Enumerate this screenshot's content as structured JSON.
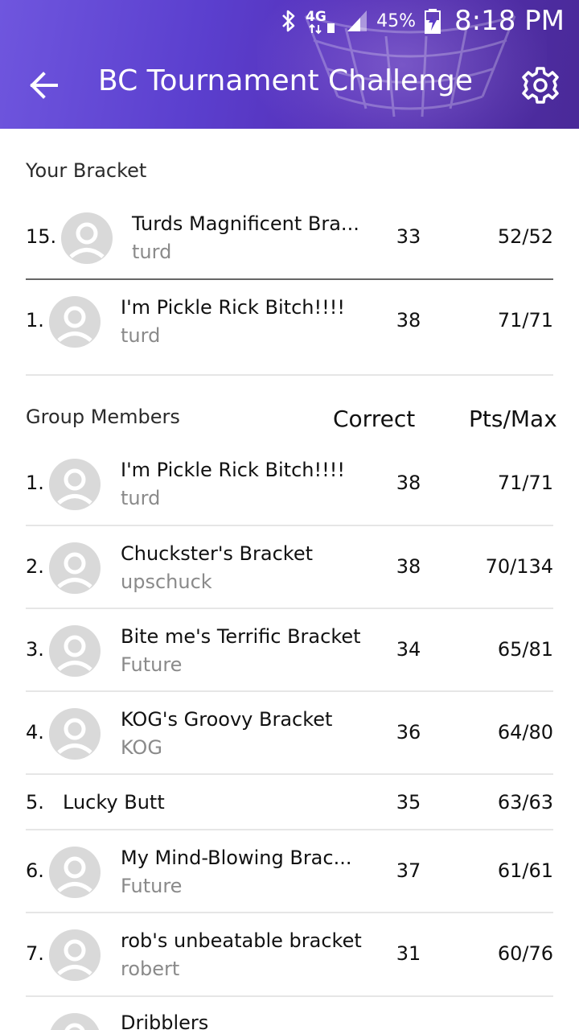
{
  "status_bar": {
    "icons": [
      "bluetooth-icon",
      "4g-lte-icon",
      "signal-icon",
      "battery-charging-icon"
    ],
    "network_label": "4G",
    "battery_percent": "45%",
    "time": "8:18 PM"
  },
  "toolbar": {
    "title": "BC Tournament Challenge",
    "back_icon": "arrow-back-icon",
    "settings_icon": "gear-icon"
  },
  "your_bracket": {
    "label": "Your Bracket",
    "rows": [
      {
        "rank": "15.",
        "name": "Turds Magnificent Bra...",
        "owner": "turd",
        "correct": "33",
        "pts": "52/52"
      },
      {
        "rank": "1.",
        "name": "I'm Pickle Rick Bitch!!!!",
        "owner": "turd",
        "correct": "38",
        "pts": "71/71"
      }
    ]
  },
  "group_members": {
    "label": "Group Members",
    "col_correct": "Correct",
    "col_pts": "Pts/Max",
    "rows": [
      {
        "rank": "1.",
        "name": "I'm Pickle Rick Bitch!!!!",
        "owner": "turd",
        "correct": "38",
        "pts": "71/71"
      },
      {
        "rank": "2.",
        "name": "Chuckster's Bracket",
        "owner": "upschuck",
        "correct": "38",
        "pts": "70/134"
      },
      {
        "rank": "3.",
        "name": "Bite me's Terrific Bracket",
        "owner": "Future",
        "correct": "34",
        "pts": "65/81"
      },
      {
        "rank": "4.",
        "name": "KOG's Groovy Bracket",
        "owner": "KOG",
        "correct": "36",
        "pts": "64/80"
      },
      {
        "rank": "5.",
        "name": "Lucky Butt",
        "owner": "",
        "correct": "35",
        "pts": "63/63"
      },
      {
        "rank": "6.",
        "name": "My Mind-Blowing Brac...",
        "owner": "Future",
        "correct": "37",
        "pts": "61/61"
      },
      {
        "rank": "7.",
        "name": "rob's unbeatable bracket",
        "owner": "robert",
        "correct": "31",
        "pts": "60/76"
      },
      {
        "rank": "",
        "name": "Dribblers",
        "owner": "",
        "correct": "",
        "pts": ""
      }
    ]
  },
  "colors": {
    "header_start": "#6f56de",
    "header_end": "#4a2a98",
    "avatar_bg": "#d9d9d9",
    "owner_text": "#8a8a8a"
  }
}
